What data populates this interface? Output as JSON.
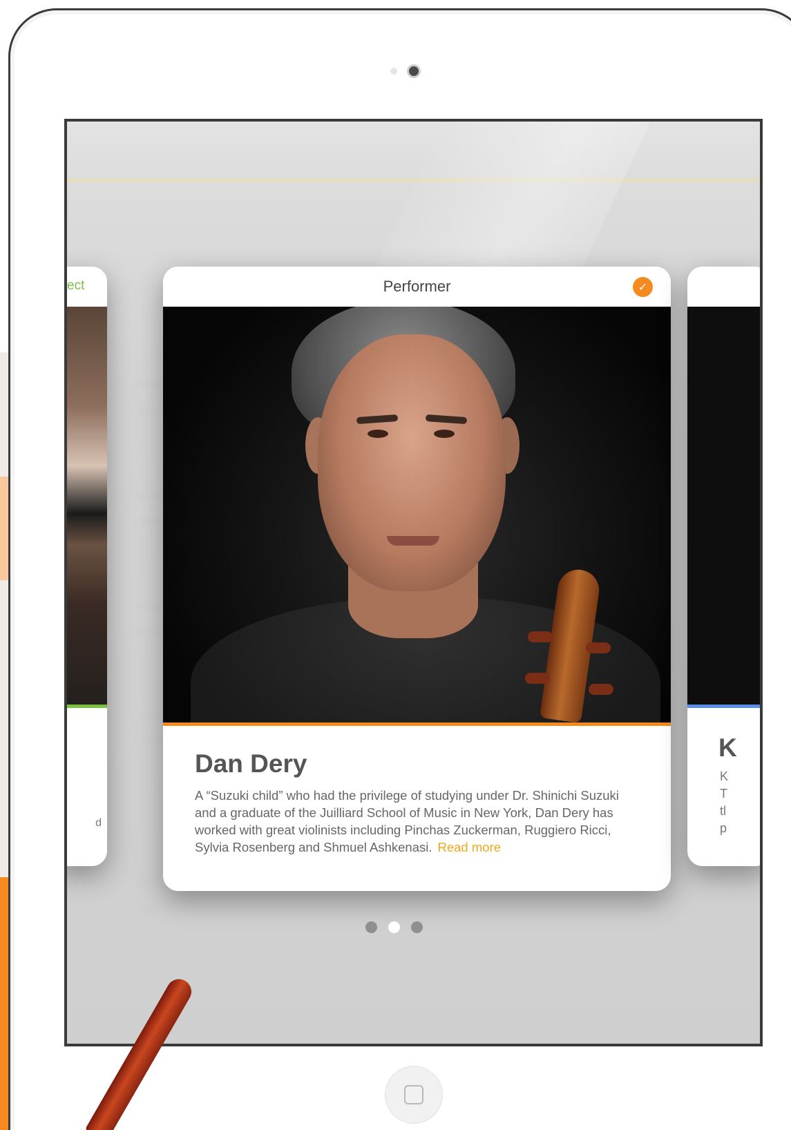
{
  "screen": {
    "current_card": {
      "header_title": "Performer",
      "selected": true,
      "name": "Dan Dery",
      "bio": "A “Suzuki child” who had the privilege of studying under Dr. Shinichi Suzuki and a graduate of the Juilliard School of Music in New York, Dan Dery has worked with great violinists including Pinchas Zuckerman, Ruggiero Ricci, Sylvia Rosenberg and Shmuel Ashkenasi.",
      "read_more": "Read more"
    },
    "previous_card": {
      "header_fragment": "ect",
      "text_fragment": "d"
    },
    "next_card": {
      "title_fragment": "K",
      "line_fragments": [
        "K",
        "T",
        "tl",
        "p"
      ]
    },
    "pager": {
      "count": 3,
      "active_index": 1
    }
  },
  "colors": {
    "accent_orange": "#f58b1f",
    "read_more": "#f0a819",
    "previous_accent_green": "#7ac142",
    "next_accent_blue": "#5b8ee6"
  },
  "icons": [
    "check-icon",
    "home-button-icon"
  ]
}
